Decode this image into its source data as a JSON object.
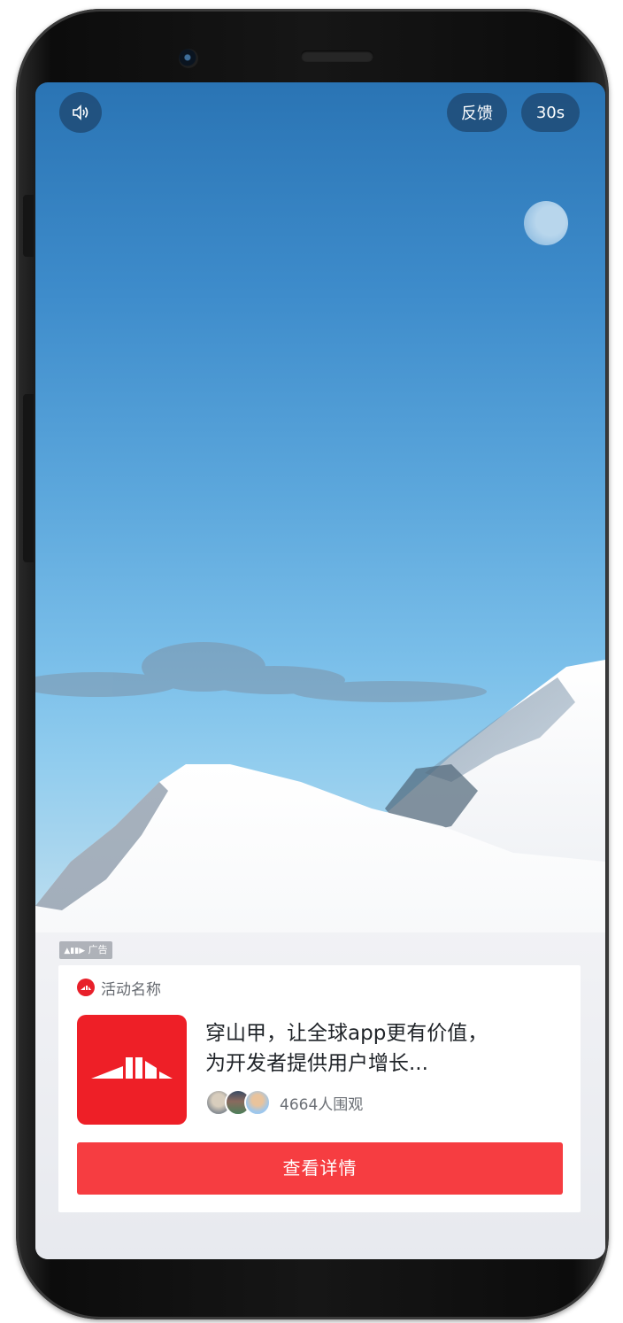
{
  "top_controls": {
    "sound_icon": "speaker-icon",
    "feedback_label": "反馈",
    "countdown_label": "30s"
  },
  "ad_tag": {
    "label": "广告",
    "icon": "pangolin-logo-icon"
  },
  "ad_card": {
    "activity_name": "活动名称",
    "headline_line1": "穿山甲，让全球app更有价值，",
    "headline_line2": "为开发者提供用户增长...",
    "viewer_count_text": "4664人围观",
    "cta_label": "查看详情",
    "avatars": [
      "avatar-1",
      "avatar-2",
      "avatar-3"
    ]
  },
  "colors": {
    "brand_red": "#ee1f27",
    "cta_red": "#f63d41",
    "control_bg": "#1e466e",
    "card_bg": "#ffffff"
  }
}
